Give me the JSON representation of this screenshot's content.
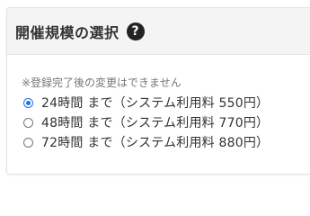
{
  "section": {
    "title": "開催規模の選択",
    "help_icon": "question-circle-icon",
    "note": "※登録完了後の変更はできません"
  },
  "options": [
    {
      "label": "24時間 まで（システム利用料 550円）",
      "checked": true
    },
    {
      "label": "48時間 まで（システム利用料 770円）",
      "checked": false
    },
    {
      "label": "72時間 まで（システム利用料 880円）",
      "checked": false
    }
  ],
  "colors": {
    "header_bg": "#f4f4f4",
    "radio_accent": "#1a73e8",
    "help_icon_bg": "#222222"
  }
}
